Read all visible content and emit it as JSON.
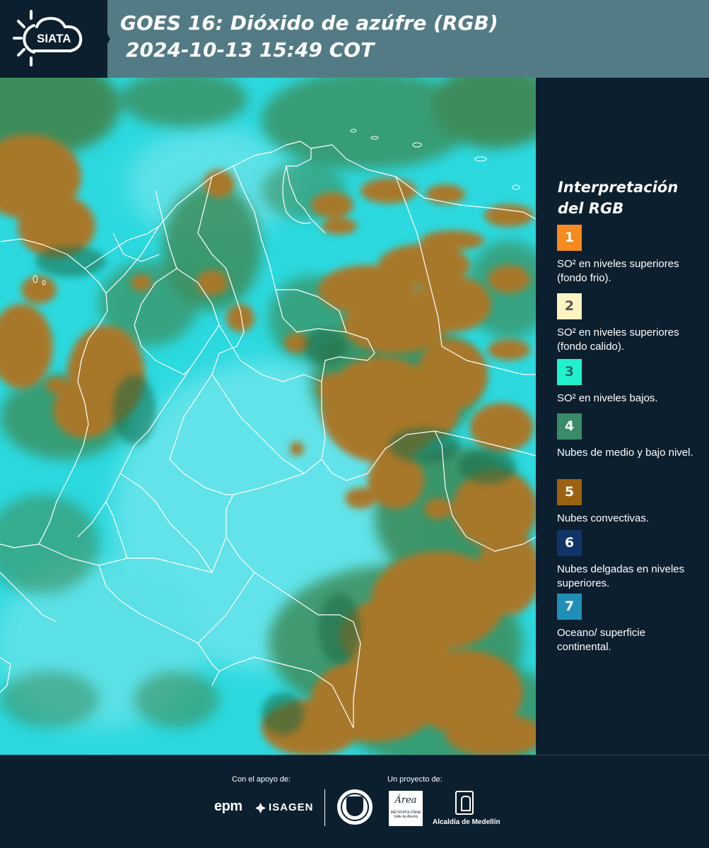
{
  "header": {
    "logo_text": "SIATA",
    "title_line1": "GOES 16: Dióxido de azúfre (RGB)",
    "title_line2": "2024-10-13 15:49 COT"
  },
  "legend": {
    "title": "Interpretación del RGB",
    "items": [
      {
        "number": "1",
        "label": "SO² en niveles superiores (fondo frio).",
        "color": "#f58a1f",
        "text_color": "#ffffff"
      },
      {
        "number": "2",
        "label": "SO² en niveles superiores (fondo calido).",
        "color": "#fdf3c1",
        "text_color": "#555555"
      },
      {
        "number": "3",
        "label": "SO² en niveles bajos.",
        "color": "#21f2cd",
        "text_color": "#1a6d6a"
      },
      {
        "number": "4",
        "label": "Nubes de medio y bajo nivel.",
        "color": "#398c67",
        "text_color": "#ffffff"
      },
      {
        "number": "5",
        "label": "Nubes convectivas.",
        "color": "#9c6210",
        "text_color": "#ffffff"
      },
      {
        "number": "6",
        "label": "Nubes delgadas en niveles superiores.",
        "color": "#113468",
        "text_color": "#ffffff"
      },
      {
        "number": "7",
        "label": "Oceano/ superficie continental.",
        "color": "#1f8fb7",
        "text_color": "#ffffff"
      }
    ]
  },
  "footer": {
    "support_label": "Con el apoyo de:",
    "project_label": "Un proyecto de:",
    "epm": "epm",
    "isagen": "ISAGEN",
    "amva": "Área",
    "amva_sub": "METROPOLITANA Valle de Aburrá",
    "alcaldia": "Alcaldía de Medellín"
  },
  "colors": {
    "background": "#0c1f2e",
    "header": "#537b85",
    "map_base": "#29d6dc",
    "convective": "#a9782a",
    "mid_low_cloud": "#3e8c5e",
    "borders": "#ffffff"
  }
}
